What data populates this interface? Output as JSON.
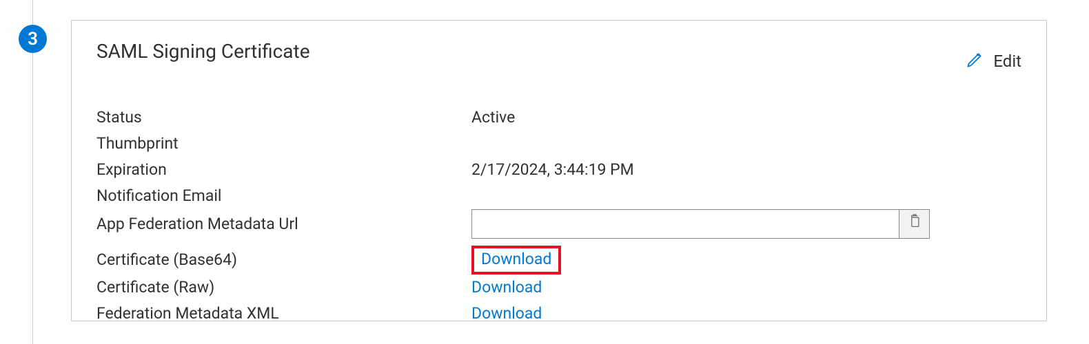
{
  "step": {
    "number": "3"
  },
  "card": {
    "title": "SAML Signing Certificate",
    "edit_label": "Edit"
  },
  "fields": {
    "status": {
      "label": "Status",
      "value": "Active"
    },
    "thumbprint": {
      "label": "Thumbprint",
      "value": ""
    },
    "expiration": {
      "label": "Expiration",
      "value": "2/17/2024, 3:44:19 PM"
    },
    "notification_email": {
      "label": "Notification Email",
      "value": ""
    },
    "federation_url": {
      "label": "App Federation Metadata Url",
      "value": ""
    },
    "cert_base64": {
      "label": "Certificate (Base64)",
      "link": "Download"
    },
    "cert_raw": {
      "label": "Certificate (Raw)",
      "link": "Download"
    },
    "metadata_xml": {
      "label": "Federation Metadata XML",
      "link": "Download"
    }
  },
  "colors": {
    "primary": "#0078d4",
    "highlight": "#e81123"
  }
}
